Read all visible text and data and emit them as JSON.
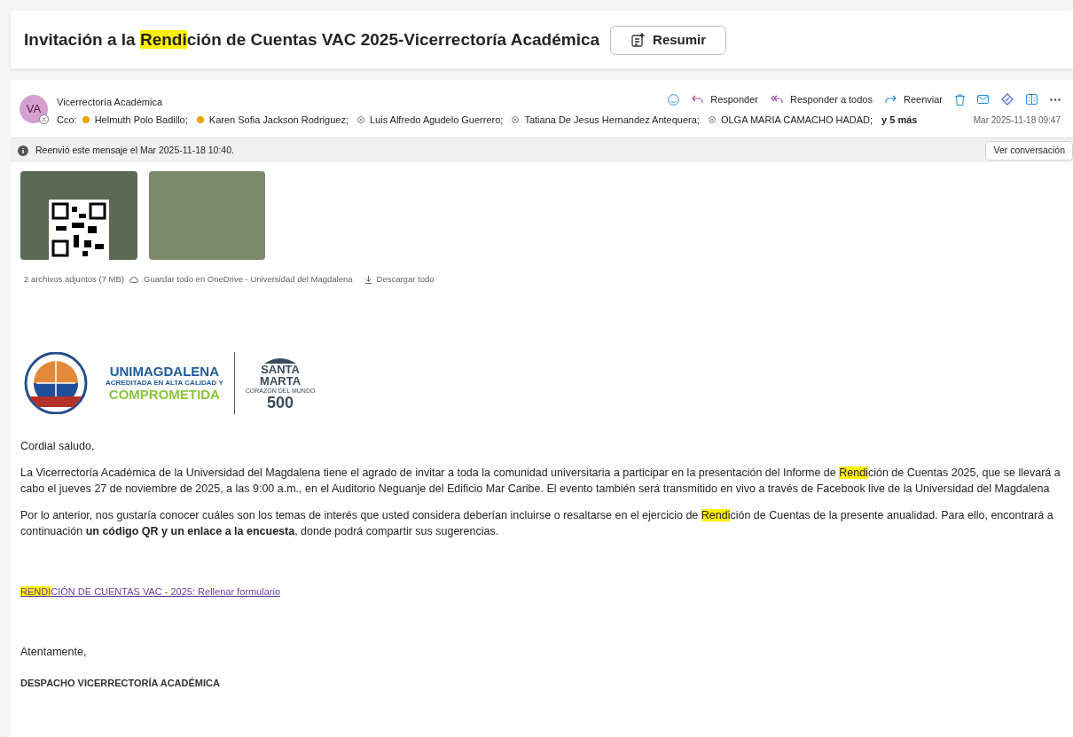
{
  "subject": {
    "segments": [
      {
        "text": "Invitación a la  ",
        "highlight": false
      },
      {
        "text": "Rendi",
        "highlight": true
      },
      {
        "text": "ción de Cuentas VAC 2025-Vicerrectoría Académica",
        "highlight": false
      }
    ]
  },
  "summarize_button": "Resumir",
  "message": {
    "avatar_initials": "VA",
    "sender": "Vicerrectoría Académica",
    "cc_label": "Cco:",
    "recipients": [
      {
        "name": "Helmuth Polo Badillo;",
        "kind": "away"
      },
      {
        "name": "Karen Sofia Jackson Rodriguez;",
        "kind": "away"
      },
      {
        "name": "Luis Alfredo Agudelo Guerrero;",
        "kind": "unknown"
      },
      {
        "name": "Tatiana De Jesus Hernandez Antequera;",
        "kind": "unknown"
      },
      {
        "name": "OLGA MARIA CAMACHO HADAD;",
        "kind": "unknown"
      }
    ],
    "more": "y 5 más",
    "date": "Mar 2025-11-18 09:47",
    "actions": [
      {
        "kind": "reply",
        "label": "Responder"
      },
      {
        "kind": "reply_all",
        "label": "Responder a todos"
      },
      {
        "kind": "forward",
        "label": "Reenviar"
      }
    ]
  },
  "info_bar": {
    "text": "Reenvió este mensaje el Mar 2025-11-18 10:40.",
    "button": "Ver conversación"
  },
  "attachments": {
    "summary": "2 archivos adjuntos (7 MB)",
    "save_all": "Guardar todo en OneDrive - Universidad del Magdalena",
    "download_all": "Descargar todo"
  },
  "logo": {
    "line_1": "UNIMAGDALENA",
    "line_2": "ACREDITADA EN ALTA CALIDAD Y",
    "line_3": "COMPROMETIDA",
    "city_1": "SANTA",
    "city_2": "MARTA",
    "tagline": "CORAZÓN DEL MUNDO",
    "number": "500"
  },
  "body": [
    {
      "kind": "paragraph",
      "segments": [
        {
          "text": "Cordial saludo,",
          "highlight": false,
          "bold": false
        }
      ]
    },
    {
      "kind": "paragraph",
      "segments": [
        {
          "text": "La Vicerrectoría Académica de la Universidad del Magdalena tiene el agrado de invitar a toda la comunidad universitaria a participar en la presentación del Informe de ",
          "highlight": false,
          "bold": false
        },
        {
          "text": "Rendi",
          "highlight": true,
          "bold": false
        },
        {
          "text": "ción de Cuentas 2025, que se llevará a cabo el jueves 27 de noviembre de 2025, a las 9:00 a.m., en el Auditorio Neguanje del Edificio Mar Caribe. El evento también será transmitido en vivo a través de Facebook live de la Universidad del Magdalena",
          "highlight": false,
          "bold": false
        }
      ]
    },
    {
      "kind": "paragraph",
      "segments": [
        {
          "text": "Por lo anterior, nos gustaría conocer cuáles son los temas de interés que usted considera deberían incluirse o resaltarse en el ejercicio de ",
          "highlight": false,
          "bold": false
        },
        {
          "text": "Rendi",
          "highlight": true,
          "bold": false
        },
        {
          "text": "ción de Cuentas de la presente anualidad. Para ello, encontrará a continuación ",
          "highlight": false,
          "bold": false
        },
        {
          "text": "un código QR y un enlace a la encuesta",
          "highlight": false,
          "bold": true
        },
        {
          "text": ", donde podrá compartir sus sugerencias.",
          "highlight": false,
          "bold": false
        }
      ]
    },
    {
      "kind": "link",
      "segments": [
        {
          "text": "RENDI",
          "highlight": true,
          "bold": false
        },
        {
          "text": "CIÓN DE CUENTAS VAC - 2025: Rellenar formulario",
          "highlight": false,
          "bold": false
        }
      ]
    },
    {
      "kind": "paragraph",
      "segments": [
        {
          "text": "Atentamente,",
          "highlight": false,
          "bold": false
        }
      ]
    },
    {
      "kind": "signature",
      "segments": [
        {
          "text": "DESPACHO VICERRECTORÍA ACADÉMICA",
          "highlight": false,
          "bold": true
        }
      ]
    }
  ]
}
